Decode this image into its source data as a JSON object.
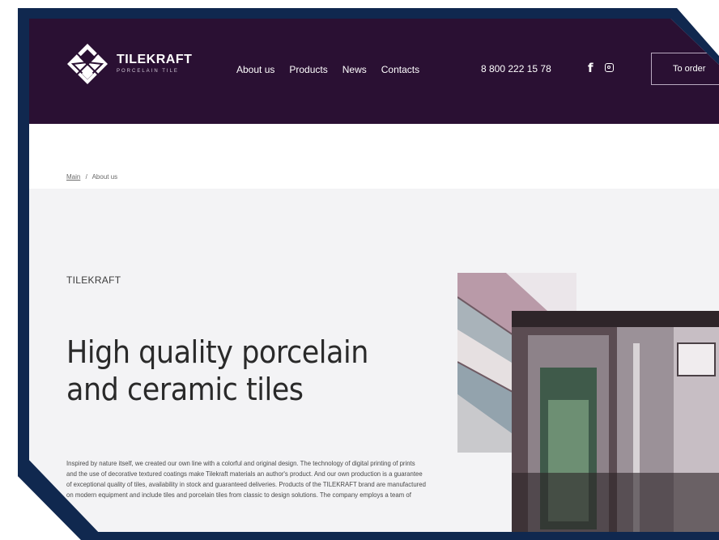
{
  "header": {
    "brand_name": "TILEKRAFT",
    "brand_sub": "PORCELAIN TILE",
    "nav": [
      "About us",
      "Products",
      "News",
      "Contacts"
    ],
    "phone": "8 800 222 15 78",
    "social": {
      "facebook": "f",
      "instagram_icon": "instagram-icon"
    },
    "order_button": "To order"
  },
  "breadcrumb": {
    "home": "Main",
    "current": "About us"
  },
  "main": {
    "eyebrow": "TILEKRAFT",
    "title": "High quality porcelain and ceramic tiles",
    "text": "Inspired by nature itself, we created our own line with a colorful and original design. The technology of digital printing of prints and the use of decorative textured coatings make Tilekraft materials an author's product. And our own production is a guarantee of exceptional quality of tiles, availability in stock and guaranteed deliveries. Products of the TILEKRAFT brand are manufactured on modern equipment and include tiles and porcelain tiles from classic to design solutions. The company employs a team of"
  },
  "colors": {
    "header_bg": "#2a1033",
    "frame": "#10284f",
    "page_bg": "#f3f3f5",
    "text": "#2a2a2a"
  }
}
